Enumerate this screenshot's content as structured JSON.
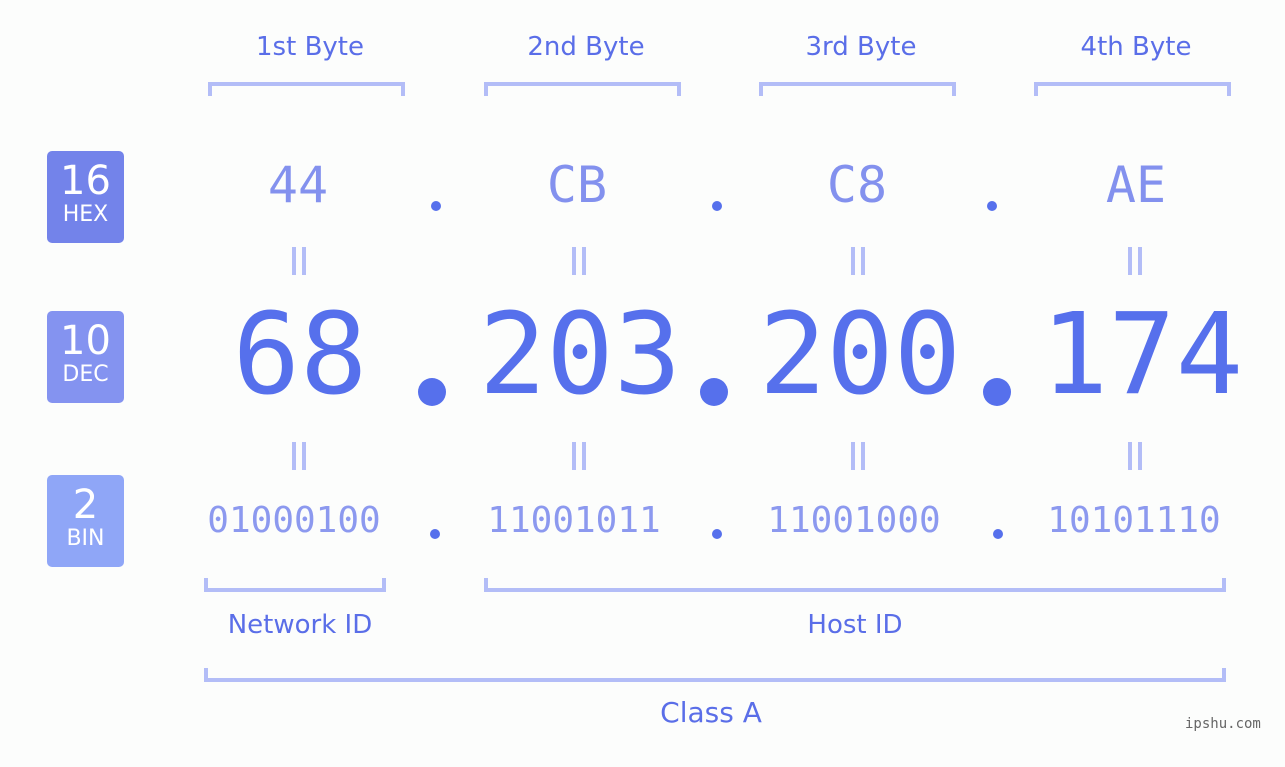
{
  "badges": [
    {
      "number": "16",
      "label": "HEX",
      "color": "#7383ea"
    },
    {
      "number": "10",
      "label": "DEC",
      "color": "#8493f0"
    },
    {
      "number": "2",
      "label": "BIN",
      "color": "#8fa6f7"
    }
  ],
  "byte_labels": [
    "1st Byte",
    "2nd Byte",
    "3rd Byte",
    "4th Byte"
  ],
  "hex": [
    "44",
    "CB",
    "C8",
    "AE"
  ],
  "dec": [
    "68",
    "203",
    "200",
    "174"
  ],
  "bin": [
    "01000100",
    "11001011",
    "11001000",
    "10101110"
  ],
  "separator": ".",
  "equals": "=",
  "groups": {
    "network": "Network ID",
    "host": "Host ID",
    "class": "Class A"
  },
  "watermark": "ipshu.com",
  "colors": {
    "accent": "#5670ec",
    "bracket": "#b3bdf7",
    "label": "#5a6ee8"
  }
}
